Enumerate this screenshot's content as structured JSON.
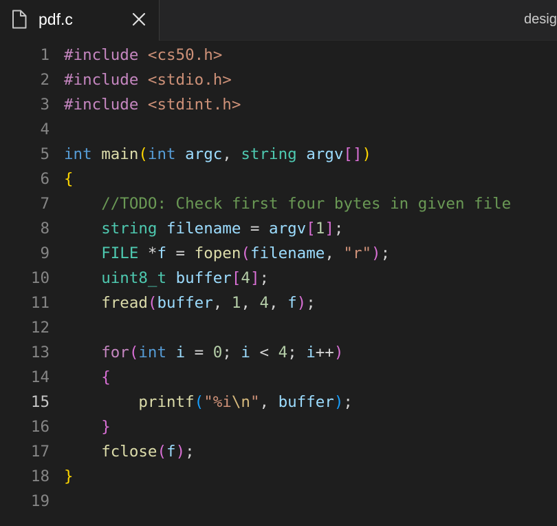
{
  "tabs": {
    "active": {
      "label": "pdf.c",
      "icon": "file-icon"
    },
    "inactive": {
      "label": "desig"
    }
  },
  "colors": {
    "editor_bg": "#1e1e1e",
    "tabbar_bg": "#252526",
    "line_number": "#858585",
    "line_number_active": "#c6c6c6"
  },
  "active_line": 15,
  "lines": [
    {
      "num": "1",
      "tokens": [
        {
          "t": "#include",
          "c": "dir"
        },
        {
          "t": " ",
          "c": "op"
        },
        {
          "t": "<cs50.h>",
          "c": "inc"
        }
      ]
    },
    {
      "num": "2",
      "tokens": [
        {
          "t": "#include",
          "c": "dir"
        },
        {
          "t": " ",
          "c": "op"
        },
        {
          "t": "<stdio.h>",
          "c": "inc"
        }
      ]
    },
    {
      "num": "3",
      "tokens": [
        {
          "t": "#include",
          "c": "dir"
        },
        {
          "t": " ",
          "c": "op"
        },
        {
          "t": "<stdint.h>",
          "c": "inc"
        }
      ]
    },
    {
      "num": "4",
      "tokens": []
    },
    {
      "num": "5",
      "tokens": [
        {
          "t": "int",
          "c": "kw"
        },
        {
          "t": " ",
          "c": "op"
        },
        {
          "t": "main",
          "c": "fn"
        },
        {
          "t": "(",
          "c": "b1"
        },
        {
          "t": "int",
          "c": "kw"
        },
        {
          "t": " ",
          "c": "op"
        },
        {
          "t": "argc",
          "c": "var"
        },
        {
          "t": ", ",
          "c": "op"
        },
        {
          "t": "string",
          "c": "type"
        },
        {
          "t": " ",
          "c": "op"
        },
        {
          "t": "argv",
          "c": "var"
        },
        {
          "t": "[]",
          "c": "b2"
        },
        {
          "t": ")",
          "c": "b1"
        }
      ]
    },
    {
      "num": "6",
      "tokens": [
        {
          "t": "{",
          "c": "b1"
        }
      ]
    },
    {
      "num": "7",
      "tokens": [
        {
          "t": "    ",
          "c": "op"
        },
        {
          "t": "//TODO: Check first four bytes in given file",
          "c": "cmt"
        }
      ]
    },
    {
      "num": "8",
      "tokens": [
        {
          "t": "    ",
          "c": "op"
        },
        {
          "t": "string",
          "c": "type"
        },
        {
          "t": " ",
          "c": "op"
        },
        {
          "t": "filename",
          "c": "var"
        },
        {
          "t": " = ",
          "c": "op"
        },
        {
          "t": "argv",
          "c": "var"
        },
        {
          "t": "[",
          "c": "b2"
        },
        {
          "t": "1",
          "c": "num"
        },
        {
          "t": "]",
          "c": "b2"
        },
        {
          "t": ";",
          "c": "op"
        }
      ]
    },
    {
      "num": "9",
      "tokens": [
        {
          "t": "    ",
          "c": "op"
        },
        {
          "t": "FILE",
          "c": "type"
        },
        {
          "t": " *",
          "c": "op"
        },
        {
          "t": "f",
          "c": "var"
        },
        {
          "t": " = ",
          "c": "op"
        },
        {
          "t": "fopen",
          "c": "fn"
        },
        {
          "t": "(",
          "c": "b2"
        },
        {
          "t": "filename",
          "c": "var"
        },
        {
          "t": ", ",
          "c": "op"
        },
        {
          "t": "\"r\"",
          "c": "str"
        },
        {
          "t": ")",
          "c": "b2"
        },
        {
          "t": ";",
          "c": "op"
        }
      ]
    },
    {
      "num": "10",
      "tokens": [
        {
          "t": "    ",
          "c": "op"
        },
        {
          "t": "uint8_t",
          "c": "type"
        },
        {
          "t": " ",
          "c": "op"
        },
        {
          "t": "buffer",
          "c": "var"
        },
        {
          "t": "[",
          "c": "b2"
        },
        {
          "t": "4",
          "c": "num"
        },
        {
          "t": "]",
          "c": "b2"
        },
        {
          "t": ";",
          "c": "op"
        }
      ]
    },
    {
      "num": "11",
      "tokens": [
        {
          "t": "    ",
          "c": "op"
        },
        {
          "t": "fread",
          "c": "fn"
        },
        {
          "t": "(",
          "c": "b2"
        },
        {
          "t": "buffer",
          "c": "var"
        },
        {
          "t": ", ",
          "c": "op"
        },
        {
          "t": "1",
          "c": "num"
        },
        {
          "t": ", ",
          "c": "op"
        },
        {
          "t": "4",
          "c": "num"
        },
        {
          "t": ", ",
          "c": "op"
        },
        {
          "t": "f",
          "c": "var"
        },
        {
          "t": ")",
          "c": "b2"
        },
        {
          "t": ";",
          "c": "op"
        }
      ]
    },
    {
      "num": "12",
      "tokens": []
    },
    {
      "num": "13",
      "tokens": [
        {
          "t": "    ",
          "c": "op"
        },
        {
          "t": "for",
          "c": "ctl"
        },
        {
          "t": "(",
          "c": "b2"
        },
        {
          "t": "int",
          "c": "kw"
        },
        {
          "t": " ",
          "c": "op"
        },
        {
          "t": "i",
          "c": "var"
        },
        {
          "t": " = ",
          "c": "op"
        },
        {
          "t": "0",
          "c": "num"
        },
        {
          "t": "; ",
          "c": "op"
        },
        {
          "t": "i",
          "c": "var"
        },
        {
          "t": " < ",
          "c": "op"
        },
        {
          "t": "4",
          "c": "num"
        },
        {
          "t": "; ",
          "c": "op"
        },
        {
          "t": "i",
          "c": "var"
        },
        {
          "t": "++",
          "c": "op"
        },
        {
          "t": ")",
          "c": "b2"
        }
      ]
    },
    {
      "num": "14",
      "tokens": [
        {
          "t": "    ",
          "c": "op"
        },
        {
          "t": "{",
          "c": "b2"
        }
      ]
    },
    {
      "num": "15",
      "tokens": [
        {
          "t": "        ",
          "c": "op"
        },
        {
          "t": "printf",
          "c": "fn"
        },
        {
          "t": "(",
          "c": "b3"
        },
        {
          "t": "\"%i",
          "c": "str"
        },
        {
          "t": "\\n",
          "c": "esc"
        },
        {
          "t": "\"",
          "c": "str"
        },
        {
          "t": ", ",
          "c": "op"
        },
        {
          "t": "buffer",
          "c": "var"
        },
        {
          "t": ")",
          "c": "b3"
        },
        {
          "t": ";",
          "c": "op"
        }
      ]
    },
    {
      "num": "16",
      "tokens": [
        {
          "t": "    ",
          "c": "op"
        },
        {
          "t": "}",
          "c": "b2"
        }
      ]
    },
    {
      "num": "17",
      "tokens": [
        {
          "t": "    ",
          "c": "op"
        },
        {
          "t": "fclose",
          "c": "fn"
        },
        {
          "t": "(",
          "c": "b2"
        },
        {
          "t": "f",
          "c": "var"
        },
        {
          "t": ")",
          "c": "b2"
        },
        {
          "t": ";",
          "c": "op"
        }
      ]
    },
    {
      "num": "18",
      "tokens": [
        {
          "t": "}",
          "c": "b1"
        }
      ]
    },
    {
      "num": "19",
      "tokens": []
    }
  ]
}
